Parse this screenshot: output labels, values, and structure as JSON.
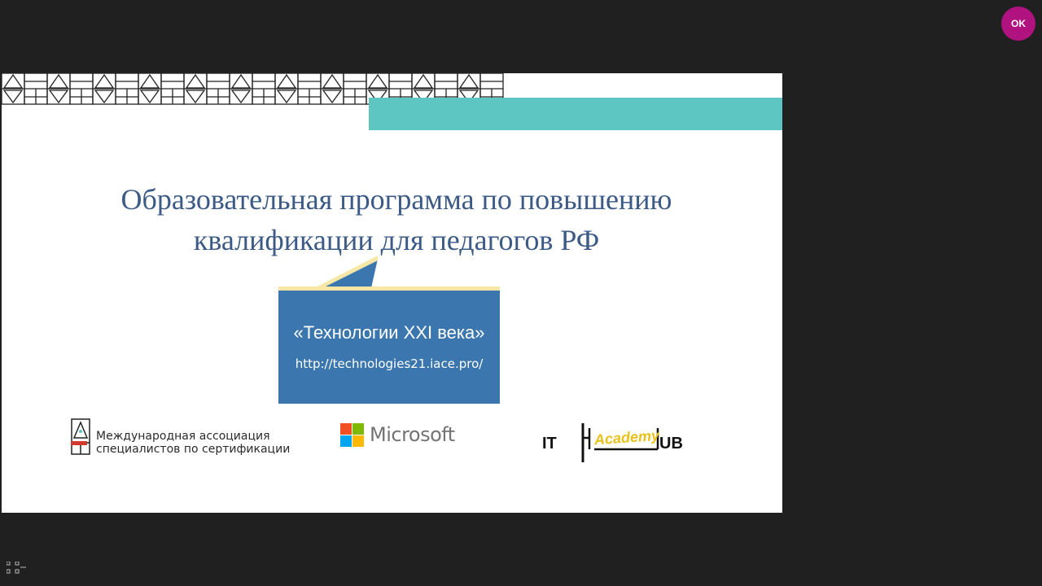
{
  "avatar": {
    "label": "OK",
    "color": "#b0127f"
  },
  "slide": {
    "title_line1": "Образовательная программа по повышению",
    "title_line2": "квалификации для педагогов РФ",
    "callout_title": "«Технологии XXI века»",
    "callout_url": "http://technologies21.iace.pro/",
    "colors": {
      "accent_teal": "#5ec6c2",
      "callout_blue": "#3b77ae",
      "title_blue": "#3b5a86"
    }
  },
  "logos": {
    "iace_line1": "Международная ассоциация",
    "iace_line2": "специалистов по сертификации",
    "microsoft": "Microsoft",
    "ithub_prefix": "IT",
    "ithub_academy": "Academy",
    "ithub_suffix": "UB"
  }
}
